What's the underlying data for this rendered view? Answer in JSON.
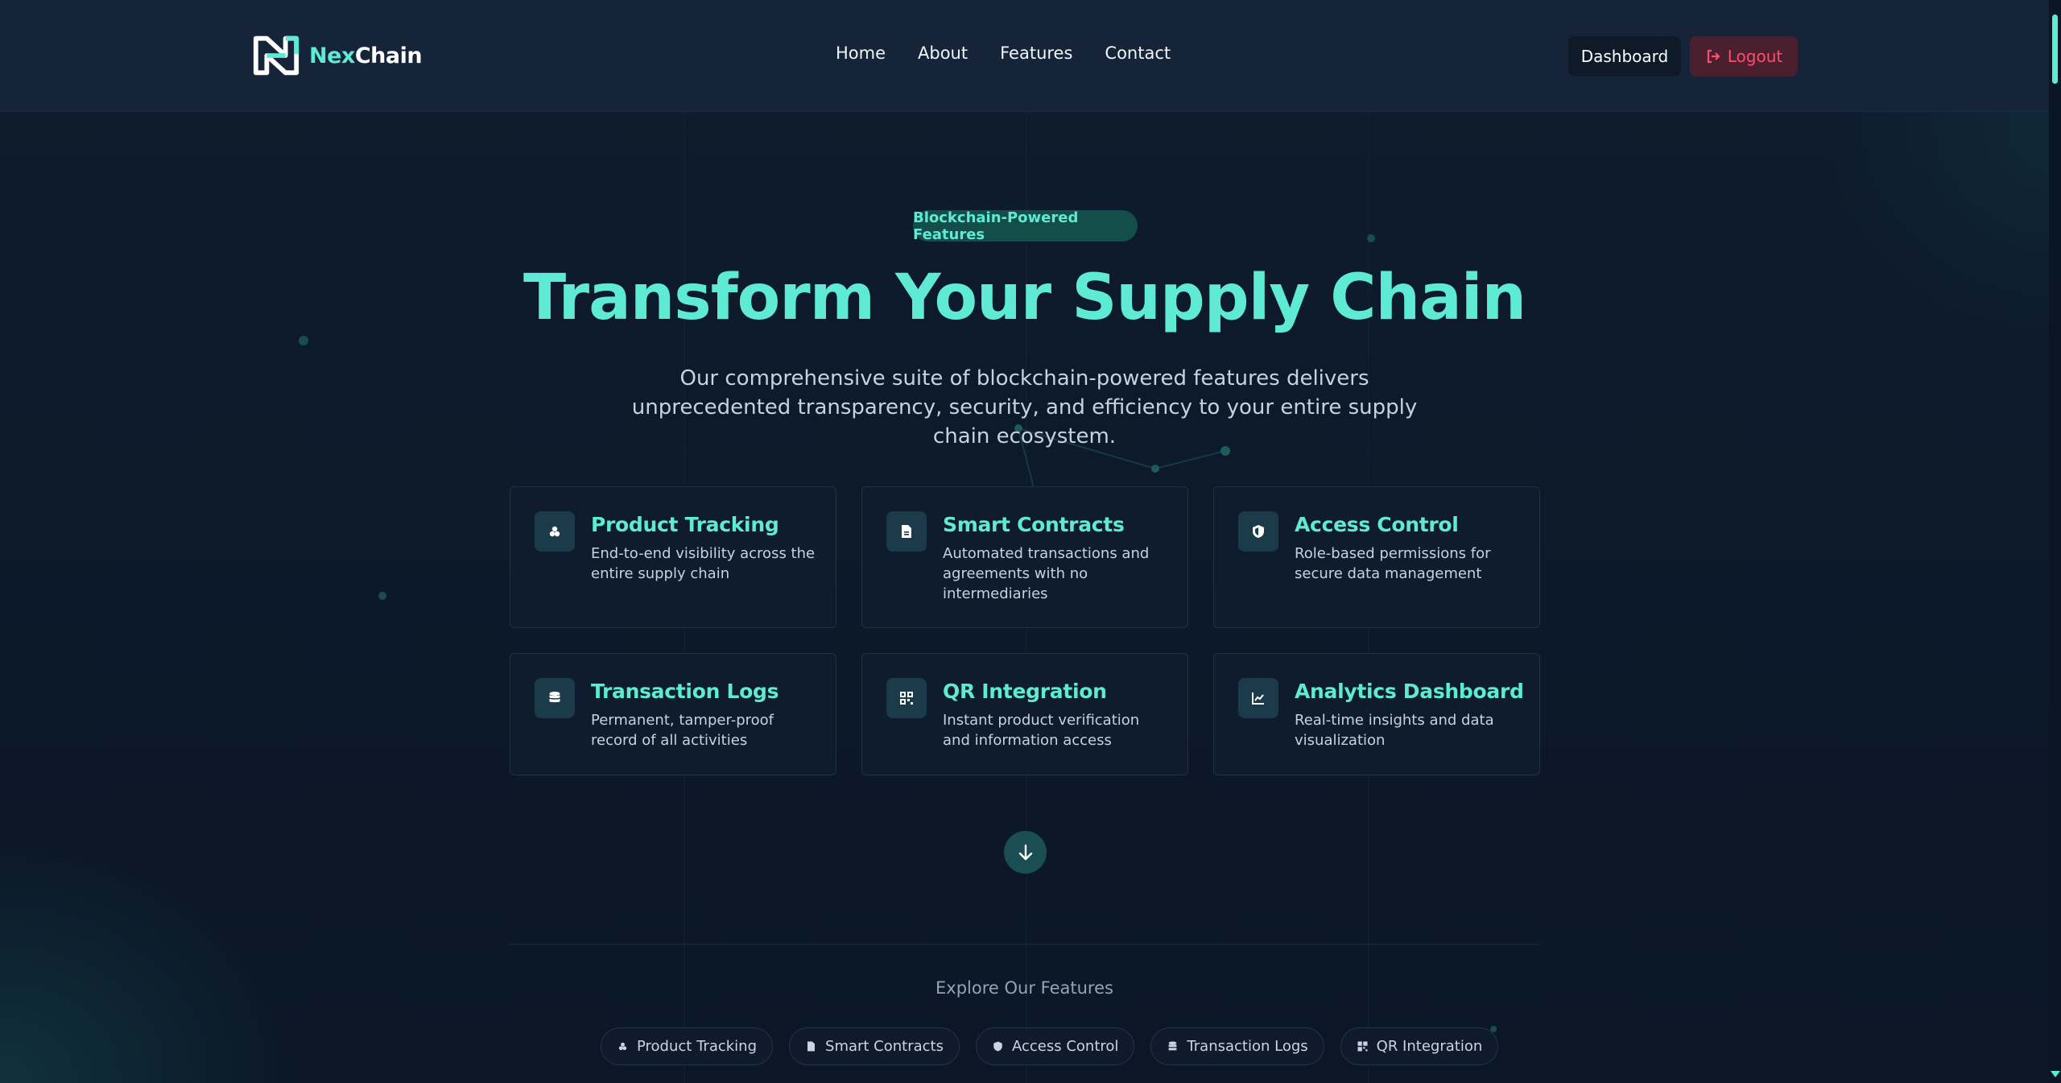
{
  "brand": {
    "name_part1": "Nex",
    "name_part2": "Chain"
  },
  "nav": {
    "links": [
      "Home",
      "About",
      "Features",
      "Contact"
    ],
    "dashboard_label": "Dashboard",
    "logout_label": "Logout"
  },
  "hero": {
    "badge": "Blockchain-Powered Features",
    "title": "Transform Your Supply Chain",
    "subtitle": "Our comprehensive suite of blockchain-powered features delivers unprecedented transparency, security, and efficiency to your entire supply chain ecosystem."
  },
  "features": [
    {
      "title": "Product Tracking",
      "desc": "End-to-end visibility across the entire supply chain",
      "icon": "product-tracking-icon"
    },
    {
      "title": "Smart Contracts",
      "desc": "Automated transactions and agreements with no intermediaries",
      "icon": "document-icon"
    },
    {
      "title": "Access Control",
      "desc": "Role-based permissions for secure data management",
      "icon": "shield-icon"
    },
    {
      "title": "Transaction Logs",
      "desc": "Permanent, tamper-proof record of all activities",
      "icon": "database-icon"
    },
    {
      "title": "QR Integration",
      "desc": "Instant product verification and information access",
      "icon": "qr-code-icon"
    },
    {
      "title": "Analytics Dashboard",
      "desc": "Real-time insights and data visualization",
      "icon": "chart-icon"
    }
  ],
  "explore": {
    "title": "Explore Our Features",
    "pills": [
      "Product Tracking",
      "Smart Contracts",
      "Access Control",
      "Transaction Logs",
      "QR Integration"
    ]
  },
  "colors": {
    "accent": "#5eead4",
    "background": "#0c1a2b",
    "logout": "#ff4d6d"
  }
}
